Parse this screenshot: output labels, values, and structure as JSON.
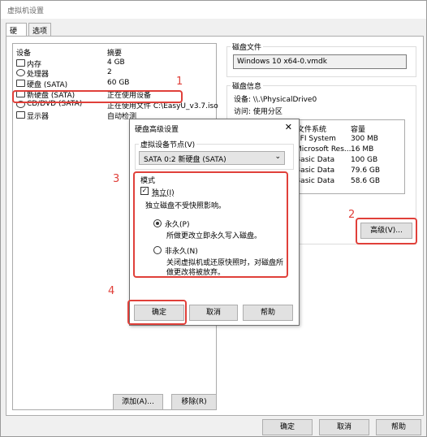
{
  "window": {
    "title": "虚拟机设置"
  },
  "tabs": [
    "硬件",
    "选项"
  ],
  "device_list": {
    "col_device": "设备",
    "col_summary": "摘要",
    "rows": [
      {
        "name": "内存",
        "summary": "4 GB",
        "icon": "memory-icon"
      },
      {
        "name": "处理器",
        "summary": "2",
        "icon": "cpu-icon"
      },
      {
        "name": "硬盘 (SATA)",
        "summary": "60 GB",
        "icon": "disk-icon"
      },
      {
        "name": "新硬盘 (SATA)",
        "summary": "正在使用设备",
        "icon": "disk-icon"
      },
      {
        "name": "CD/DVD (SATA)",
        "summary": "正在使用文件 C:\\EasyU_v3.7.iso",
        "icon": "cd-icon"
      },
      {
        "name": "显示器",
        "summary": "自动检测",
        "icon": "monitor-icon"
      }
    ],
    "add_button": "添加(A)...",
    "remove_button": "移除(R)"
  },
  "disk_file": {
    "group_label": "磁盘文件",
    "value": "Windows 10 x64-0.vmdk"
  },
  "disk_info": {
    "group_label": "磁盘信息",
    "device_line": "设备: \\\\.\\PhysicalDrive0",
    "access_line": "访问: 使用分区",
    "table": {
      "col_fs": "文件系统",
      "col_cap": "容量",
      "rows": [
        {
          "fs": "EFI System",
          "cap": "300 MB"
        },
        {
          "fs": "Microsoft Res...",
          "cap": "16 MB"
        },
        {
          "fs": "Basic Data",
          "cap": "100 GB"
        },
        {
          "fs": "Basic Data",
          "cap": "79.6 GB"
        },
        {
          "fs": "Basic Data",
          "cap": "58.6 GB"
        }
      ]
    },
    "advanced_button": "高级(V)..."
  },
  "bottom_buttons": {
    "ok": "确定",
    "cancel": "取消",
    "help": "帮助"
  },
  "dialog": {
    "title": "硬盘高级设置",
    "close": "✕",
    "node_label": "虚拟设备节点(V)",
    "node_value": "SATA 0:2  新硬盘 (SATA)",
    "mode_label": "模式",
    "independent_label": "独立(I)",
    "independent_desc": "独立磁盘不受快照影响。",
    "persistent_label": "永久(P)",
    "persistent_desc": "所做更改立即永久写入磁盘。",
    "nonpersistent_label": "非永久(N)",
    "nonpersistent_desc_1": "关闭虚拟机或还原快照时，对磁盘所",
    "nonpersistent_desc_2": "做更改将被放弃。",
    "ok": "确定",
    "cancel": "取消",
    "help": "帮助"
  },
  "annotations": [
    "1",
    "2",
    "3",
    "4"
  ],
  "colors": {
    "annotation": "#e0403a"
  }
}
